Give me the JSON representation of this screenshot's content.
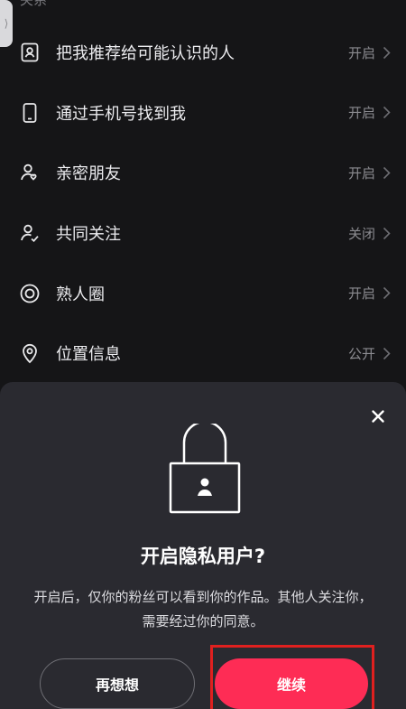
{
  "section_label": "关系",
  "settings": [
    {
      "icon": "contact-card-icon",
      "label": "把我推荐给可能认识的人",
      "value": "开启"
    },
    {
      "icon": "phone-icon",
      "label": "通过手机号找到我",
      "value": "开启"
    },
    {
      "icon": "close-friend-icon",
      "label": "亲密朋友",
      "value": "开启"
    },
    {
      "icon": "mutual-follow-icon",
      "label": "共同关注",
      "value": "关闭"
    },
    {
      "icon": "circle-target-icon",
      "label": "熟人圈",
      "value": "开启"
    },
    {
      "icon": "location-pin-icon",
      "label": "位置信息",
      "value": "公开"
    }
  ],
  "dialog": {
    "title": "开启隐私用户?",
    "description": "开启后，仅你的粉丝可以看到你的作品。其他人关注你，需要经过你的同意。",
    "cancel_label": "再想想",
    "confirm_label": "继续"
  },
  "colors": {
    "background": "#151517",
    "sheet": "#2a2a30",
    "accent": "#fe2c55",
    "highlight": "#e0201f"
  }
}
